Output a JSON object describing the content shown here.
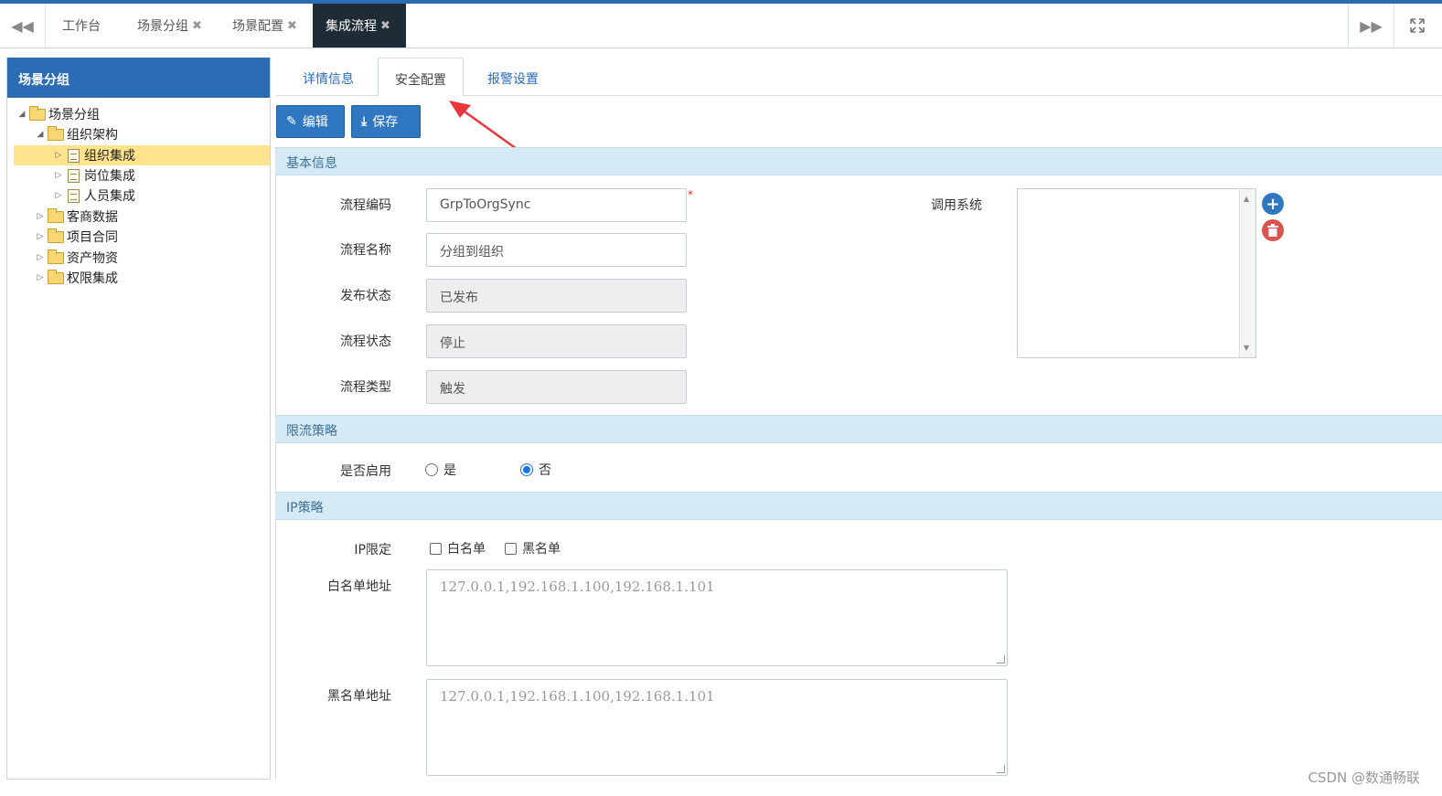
{
  "top_tabs": {
    "t1": "工作台",
    "t2": "场景分组",
    "t3": "场景配置",
    "t4": "集成流程",
    "close_glyph": "✖"
  },
  "sidebar": {
    "title": "场景分组",
    "tree": {
      "root": "场景分组",
      "org": "组织架构",
      "org_child1": "组织集成",
      "org_child2": "岗位集成",
      "org_child3": "人员集成",
      "merchant": "客商数据",
      "contract": "项目合同",
      "assets": "资产物资",
      "perm": "权限集成"
    }
  },
  "sub_tabs": {
    "details": "详情信息",
    "security": "安全配置",
    "alert": "报警设置"
  },
  "toolbar": {
    "edit": "编辑",
    "save": "保存"
  },
  "basic": {
    "section_title": "基本信息",
    "code_label": "流程编码",
    "code_value": "GrpToOrgSync",
    "required_mark": "*",
    "name_label": "流程名称",
    "name_value": "分组到组织",
    "publish_label": "发布状态",
    "publish_value": "已发布",
    "status_label": "流程状态",
    "status_value": "停止",
    "type_label": "流程类型",
    "type_value": "触发",
    "system_label": "调用系统"
  },
  "ratelimit": {
    "section_title": "限流策略",
    "enable_label": "是否启用",
    "yes": "是",
    "no": "否",
    "selected": "否"
  },
  "ip": {
    "section_title": "IP策略",
    "limit_label": "IP限定",
    "whitelist_opt": "白名单",
    "blacklist_opt": "黑名单",
    "whitelist_addr_label": "白名单地址",
    "whitelist_placeholder": "127.0.0.1,192.168.1.100,192.168.1.101",
    "blacklist_addr_label": "黑名单地址",
    "blacklist_placeholder": "127.0.0.1,192.168.1.100,192.168.1.101"
  },
  "watermark": "CSDN @数通畅联",
  "colors": {
    "primary": "#2b6cb5",
    "section_bg": "#d6eaf5",
    "annotation_arrow": "#e8383d"
  }
}
